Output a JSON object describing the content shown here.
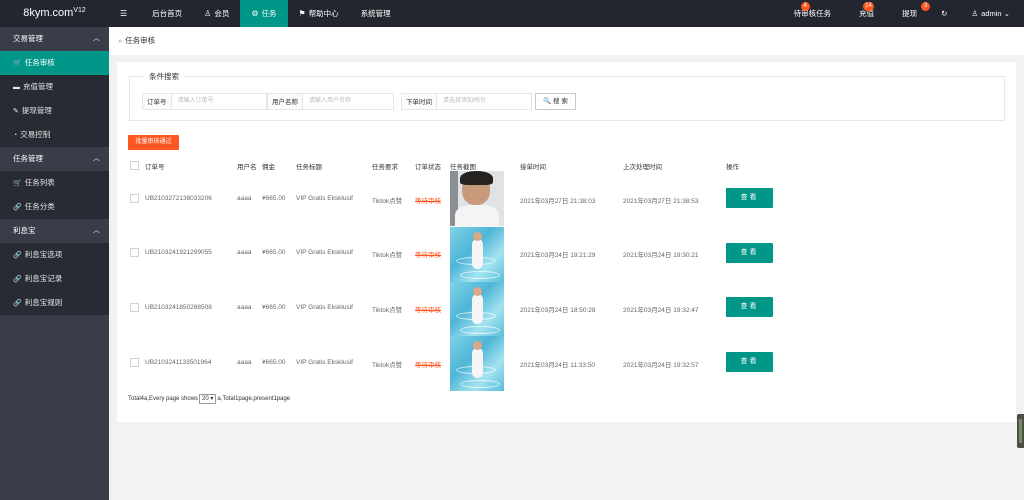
{
  "brand": {
    "name": "8kym.com",
    "version": "V12"
  },
  "topnav": {
    "menu_icon": "hamburger-icon",
    "items": [
      {
        "label": "后台首页"
      },
      {
        "label": "会员"
      },
      {
        "label": "任务"
      },
      {
        "label": "帮助中心"
      },
      {
        "label": "系统管理"
      }
    ],
    "right": [
      {
        "label": "待审核任务",
        "badge": "4"
      },
      {
        "label": "充值",
        "badge": "14"
      },
      {
        "label": "提现",
        "badge": "3"
      }
    ],
    "user": "admin"
  },
  "sidebar": [
    {
      "label": "交易管理",
      "items": [
        {
          "label": "任务审核",
          "active": true
        },
        {
          "label": "充值管理"
        },
        {
          "label": "提现管理"
        },
        {
          "label": "交易控制"
        }
      ]
    },
    {
      "label": "任务管理",
      "items": [
        {
          "label": "任务列表"
        },
        {
          "label": "任务分类"
        }
      ]
    },
    {
      "label": "利息宝",
      "items": [
        {
          "label": "利息宝选项"
        },
        {
          "label": "利息宝记录"
        },
        {
          "label": "利息宝规则"
        }
      ]
    }
  ],
  "breadcrumb": "任务审核",
  "filter": {
    "legend": "条件搜索",
    "order_label": "订单号",
    "order_placeholder": "请输入订单号",
    "user_label": "用户名称",
    "user_placeholder": "请输入用户名称",
    "time_label": "下单时间",
    "time_placeholder": "请选择添加时间",
    "search_button": "搜 索"
  },
  "batch_button": "批量审核通过",
  "table": {
    "headers": [
      "订单号",
      "用户名",
      "佣金",
      "任务标题",
      "任务要求",
      "订单状态",
      "任务截图",
      "接单时间",
      "上次处理时间",
      "操作"
    ],
    "rows": [
      {
        "order": "UB2103272138033206",
        "user": "aaaa",
        "commission": "¥665.00",
        "title": "VIP Gratis Eksklusif",
        "requirement": "Tiktok点赞",
        "status": "等待审核",
        "shot": "selfie",
        "accept_time": "2021年03月27日 21:38:03",
        "last_time": "2021年03月27日 21:38:53",
        "action": "查看"
      },
      {
        "order": "UB2103241921299055",
        "user": "aaaa",
        "commission": "¥665.00",
        "title": "VIP Gratis Eksklusif",
        "requirement": "Tiktok点赞",
        "status": "等待审核",
        "shot": "pool",
        "accept_time": "2021年03月24日 19:21:29",
        "last_time": "2021年03月24日 19:30:21",
        "action": "查看"
      },
      {
        "order": "UB2103241850288508",
        "user": "aaaa",
        "commission": "¥665.00",
        "title": "VIP Gratis Eksklusif",
        "requirement": "Tiktok点赞",
        "status": "等待审核",
        "shot": "pool",
        "accept_time": "2021年03月24日 18:50:28",
        "last_time": "2021年03月24日 19:32:47",
        "action": "查看"
      },
      {
        "order": "UB2103241133501964",
        "user": "aaaa",
        "commission": "¥665.00",
        "title": "VIP Gratis Eksklusif",
        "requirement": "Tiktok点赞",
        "status": "等待审核",
        "shot": "pool",
        "accept_time": "2021年03月24日 11:33:50",
        "last_time": "2021年03月24日 19:32:57",
        "action": "查看"
      }
    ]
  },
  "pager": {
    "prefix": "Total4a,Every page shows",
    "page_size": "20",
    "suffix": "a,Total1page,present1page"
  },
  "colors": {
    "accent": "#009688",
    "danger": "#ff5722",
    "sidebar": "#393d49",
    "topbar": "#23262e"
  }
}
